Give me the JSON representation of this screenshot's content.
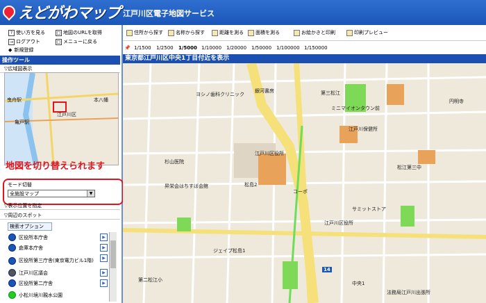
{
  "header": {
    "logo_text": "えどがわマップ",
    "title": "江戸川区電子地図サービス"
  },
  "left_links": [
    "使い方を見る",
    "地図のURLを取得",
    "ログアウト",
    "メニューに戻る",
    "新規登録"
  ],
  "tools_title": "操作ツール",
  "overview_label": "▽広域図表示",
  "minimap_labels": [
    "曳舟駅",
    "本八幡",
    "亀戸駅",
    "江戸川区",
    "都営新宿線"
  ],
  "red_note": "地図を切り替えられます",
  "mode_label": "モード切替",
  "mode_value": "全施設マップ",
  "sections": [
    "▽表示位置を指定",
    "▽周辺のスポット",
    "検索オプション"
  ],
  "facility_list": [
    "区役所本庁舎",
    "倉庫本庁舎",
    "区役所第三庁舎(東京電力ビル1階)",
    "江戸川区議会",
    "区役所第二庁舎",
    "小松川境川親水公園"
  ],
  "toolbar": [
    "住所から探す",
    "名称から探す",
    "距離を測る",
    "面積を測る",
    "お絵かきと印刷",
    "印刷プレビュー"
  ],
  "scales": [
    "1/1500",
    "1/2500",
    "1/5000",
    "1/10000",
    "1/20000",
    "1/50000",
    "1/100000",
    "1/150000"
  ],
  "current_scale": "1/5000",
  "map_title": "東京都江戸川区中央1丁目付近を表示",
  "map_labels": [
    "ヨシノ歯科クリニック",
    "銀河書房",
    "第三松江",
    "江戸川区役所",
    "松島2",
    "サミットストア",
    "江戸川保健所",
    "松江第三中",
    "江戸川区役所",
    "杉山医院",
    "中央1",
    "法務局江戸川出張所",
    "第二松江小",
    "ミニマイオンタウン前",
    "昇栄会はちすば会館",
    "コーポ",
    "ジェイプ松島1",
    "円明寺"
  ],
  "map_route_number": "14",
  "colors": {
    "header": "#1a56b8",
    "bar": "#1c4fb2",
    "accent_red": "#e5121a",
    "road_yellow": "#f6e07a",
    "green": "#7ed957"
  }
}
